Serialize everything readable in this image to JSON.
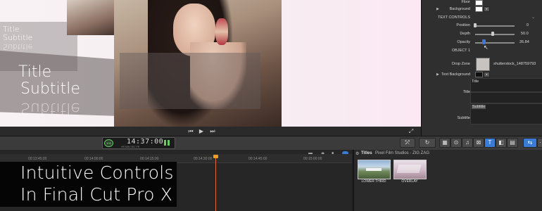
{
  "viewer": {
    "small_title": "Title",
    "small_subtitle": "Subtitle",
    "small_subtitle_reflection": "Subtitle",
    "large_title": "Title",
    "large_subtitle": "Subtitle",
    "large_subtitle_reflection": "Subtitle"
  },
  "transport": {
    "prev_icon": "skip-back-icon",
    "play_icon": "play-icon",
    "next_icon": "skip-forward-icon",
    "fullscreen_icon": "fullscreen-icon"
  },
  "inspector": {
    "floor_label": "Floor",
    "background_label": "Background",
    "text_controls_label": "TEXT CONTROLS",
    "position_label": "Position",
    "position_value": "0",
    "depth_label": "Depth",
    "depth_value": "50.0",
    "opacity_label": "Opacity",
    "opacity_value": "26.84",
    "object_label": "OBJECT 1",
    "drop_zone_label": "Drop Zone",
    "drop_zone_file": "shutterstock_148759793",
    "text_background_label": "Text Background",
    "title_label": "Title",
    "title_value": "Title",
    "subtitle_label": "Subtitle",
    "subtitle_value": "Subtitle"
  },
  "toolbar": {
    "timecode_badge": "100",
    "timecode": "14:37:00",
    "timecode_units": "HR  MIN  SEC  FR"
  },
  "timeline": {
    "ticks": [
      "00:13:45:00",
      "00:14:00:00",
      "00:14:15:00",
      "00:14:30:00",
      "00:14:45:00",
      "00:15:00:00"
    ]
  },
  "browser": {
    "titles_label": "Titles",
    "path": "Pixel Film Studios - ZIG ZAG",
    "items": [
      {
        "label": "LOWER THIRD"
      },
      {
        "label": "OVERLAY"
      }
    ]
  },
  "caption": {
    "line1": "Intuitive Controls",
    "line2": "In Final Cut Pro X"
  },
  "colors": {
    "playhead": "#e56a3a",
    "accent_blue": "#3a7bd5",
    "caption_bg": "#050505"
  }
}
